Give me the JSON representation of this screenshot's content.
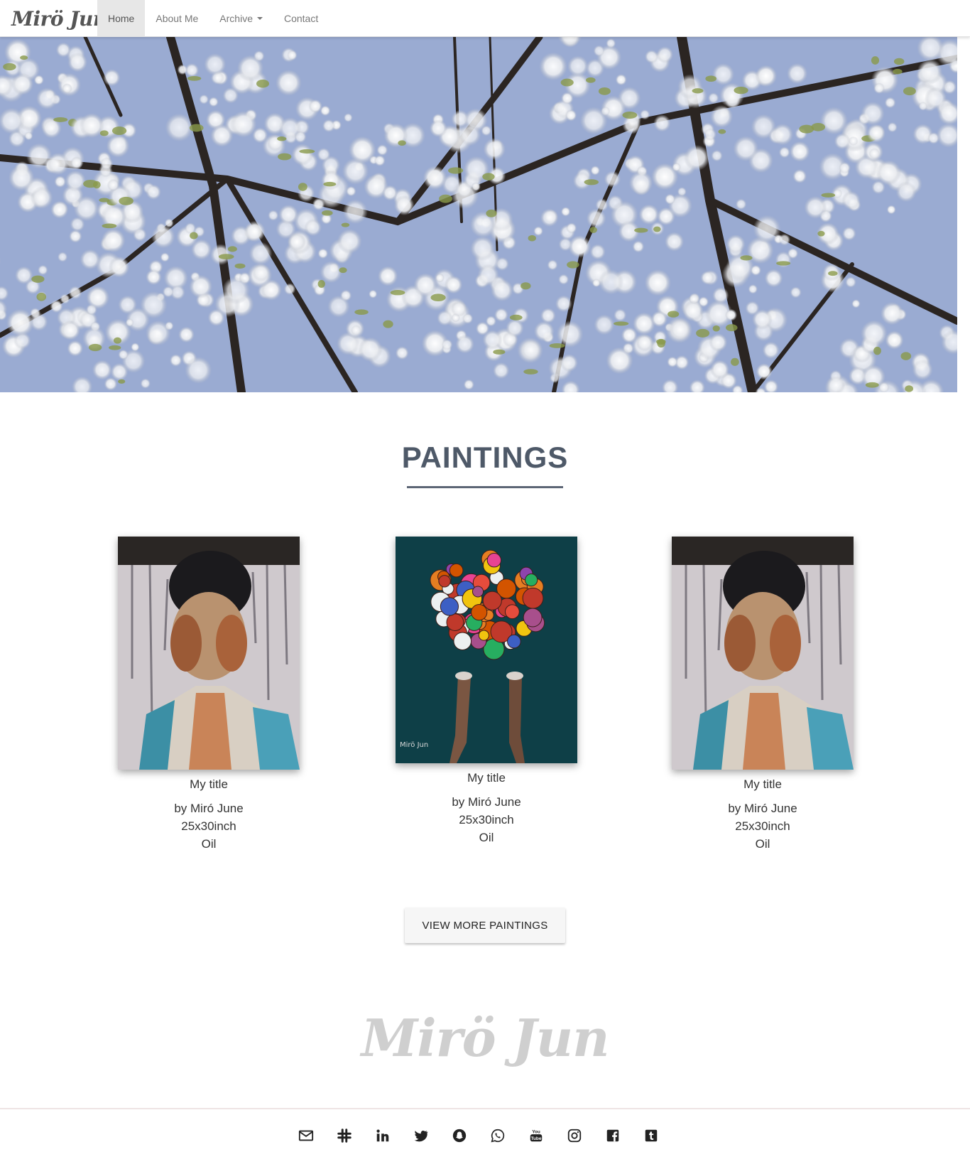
{
  "nav": {
    "brand": "Mirö Jun",
    "links": [
      {
        "label": "Home",
        "active": true
      },
      {
        "label": "About Me"
      },
      {
        "label": "Archive"
      },
      {
        "label": "Contact"
      }
    ]
  },
  "section": {
    "title": "PAINTINGS"
  },
  "paintings": [
    {
      "title": "My title",
      "artist": "by Miró June",
      "size": "25x30inch",
      "medium": "Oil",
      "art": "woman-face-hands"
    },
    {
      "title": "My title",
      "artist": "by Miró June",
      "size": "25x30inch",
      "medium": "Oil",
      "art": "flower-bouquet-hands",
      "signature": "Mirö Jun"
    },
    {
      "title": "My title",
      "artist": "by Miró June",
      "size": "25x30inch",
      "medium": "Oil",
      "art": "woman-face-hands"
    }
  ],
  "more_button": "VIEW MORE PAINTINGS",
  "footer": {
    "logo": "Mirö Jun",
    "social_icons": [
      "mail-icon",
      "slack-icon",
      "linkedin-icon",
      "twitter-icon",
      "snapchat-icon",
      "whatsapp-icon",
      "youtube-icon",
      "instagram-icon",
      "facebook-icon",
      "tumblr-icon"
    ]
  },
  "colors": {
    "title": "#4e5968",
    "sky": "#9fb0d6",
    "footer_logo": "#cfcfcf"
  }
}
